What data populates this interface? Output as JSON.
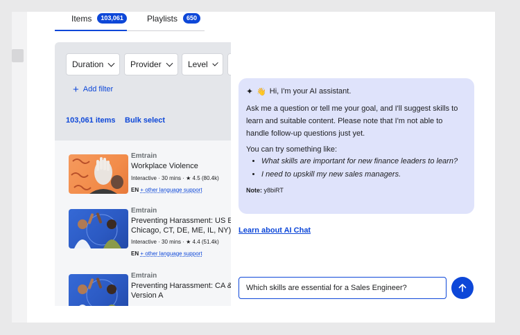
{
  "catalog": {
    "tabs": [
      {
        "label": "Items",
        "badge": "103,061"
      },
      {
        "label": "Playlists",
        "badge": "650"
      }
    ],
    "filters": [
      {
        "label": "Duration"
      },
      {
        "label": "Provider"
      },
      {
        "label": "Level"
      }
    ],
    "add_filter_label": "Add filter",
    "items_count": "103,061 items",
    "bulk_select_label": "Bulk select",
    "results": [
      {
        "provider": "Emtrain",
        "title": "Workplace Violence",
        "title_line2": "",
        "meta": "Interactive · 30 mins · ★ 4.5 (80.4k)",
        "lang_code": "EN",
        "lang_link": "+ other language support"
      },
      {
        "provider": "Emtrain",
        "title": "Preventing Harassment: US E",
        "title_line2": "Chicago, CT, DE, ME, IL, NY) - V",
        "meta": "Interactive · 30 mins · ★ 4.4 (51.4k)",
        "lang_code": "EN",
        "lang_link": "+ other language support"
      },
      {
        "provider": "Emtrain",
        "title": "Preventing Harassment: CA &",
        "title_line2": "Version A",
        "meta": "",
        "lang_code": "",
        "lang_link": ""
      }
    ]
  },
  "chat": {
    "greeting": "Hi, I'm your AI assistant.",
    "intro": "Ask me a question or tell me your goal, and I'll suggest skills to learn and suitable content. Please note that I'm not able to handle follow-up questions just yet.",
    "try_label": "You can try something like:",
    "suggestions": [
      "What skills are important for new finance leaders to learn?",
      "I need to upskill my new sales managers."
    ],
    "note_label": "Note:",
    "note_value": "y8biRT",
    "learn_link": "Learn about AI Chat",
    "input_value": "Which skills are essential for a Sales Engineer?"
  },
  "colors": {
    "accent": "#0d47d8",
    "bubble": "#dfe3fb",
    "filter_panel": "#e4e6ea"
  },
  "icons": [
    "chevron-down-icon",
    "plus-icon",
    "sparkle-icon",
    "wave-icon",
    "arrow-up-icon"
  ]
}
